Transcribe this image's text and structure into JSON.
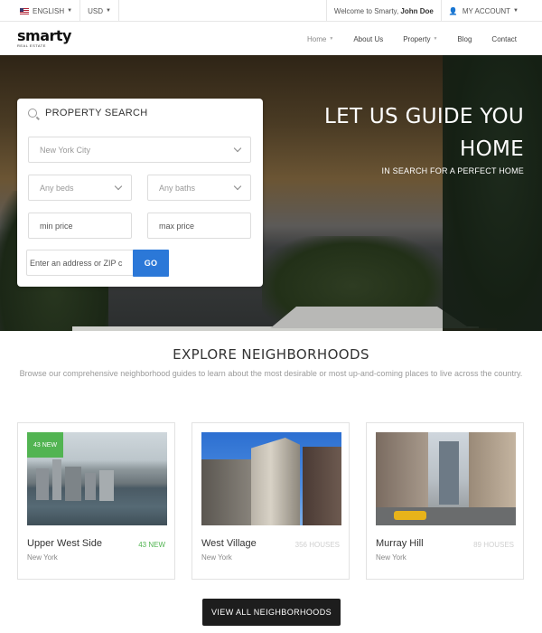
{
  "topbar": {
    "language": "ENGLISH",
    "currency": "USD",
    "welcome_prefix": "Welcome to Smarty,",
    "user_name": "John Doe",
    "account_label": "MY ACCOUNT"
  },
  "header": {
    "logo_word": "smarty",
    "logo_sub": "REAL ESTATE",
    "nav": [
      {
        "label": "Home"
      },
      {
        "label": "About Us"
      },
      {
        "label": "Property"
      },
      {
        "label": "Blog"
      },
      {
        "label": "Contact"
      }
    ]
  },
  "hero": {
    "headline_line1": "LET US GUIDE YOU",
    "headline_line2": "HOME",
    "subheadline": "IN SEARCH FOR A PERFECT HOME"
  },
  "search": {
    "title": "PROPERTY SEARCH",
    "city_value": "New York City",
    "beds_value": "Any beds",
    "baths_value": "Any baths",
    "min_price_placeholder": "min price",
    "max_price_placeholder": "max price",
    "address_placeholder": "Enter an address or ZIP c",
    "go_label": "GO"
  },
  "explore": {
    "title": "EXPLORE NEIGHBORHOODS",
    "description": "Browse our comprehensive neighborhood guides to learn about the most desirable or most up-and-coming places to live across the country.",
    "cards": [
      {
        "badge": "43 NEW",
        "name": "Upper West Side",
        "city": "New York",
        "count": "43 NEW"
      },
      {
        "name": "West Village",
        "city": "New York",
        "count": "356 HOUSES"
      },
      {
        "name": "Murray Hill",
        "city": "New York",
        "count": "89 HOUSES"
      }
    ],
    "view_all_label": "VIEW ALL NEIGHBORHOODS"
  },
  "colors": {
    "accent_blue": "#2b78d8",
    "badge_green": "#52b452",
    "dark_button": "#1d1d1d"
  }
}
